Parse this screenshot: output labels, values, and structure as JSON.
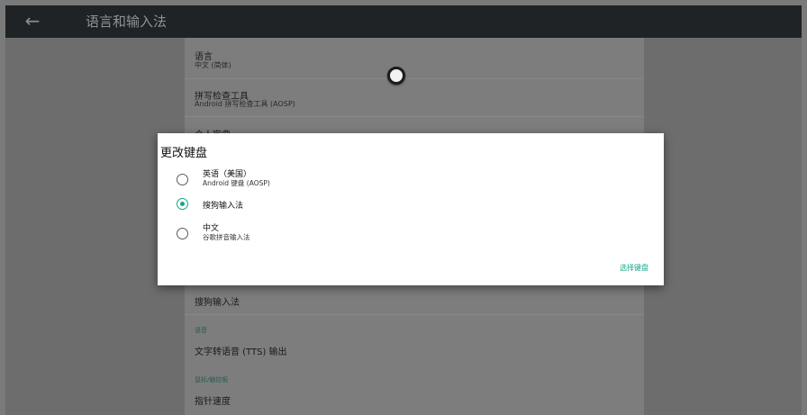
{
  "appbar": {
    "back_icon": "arrow-left-icon",
    "title": "语言和输入法"
  },
  "settings": {
    "language": {
      "title": "语言",
      "subtitle": "中文 (简体)"
    },
    "spellcheck": {
      "title": "拼写检查工具",
      "subtitle": "Android 拼写检查工具 (AOSP)"
    },
    "personal_dict": {
      "title": "个人字典"
    },
    "current_keyboard": {
      "title": "搜狗输入法"
    },
    "speech_category": "语音",
    "tts": {
      "title": "文字转语音 (TTS) 输出"
    },
    "pointer_category": "鼠标/触控板",
    "pointer_speed": {
      "title": "指针速度"
    }
  },
  "dialog": {
    "title": "更改键盘",
    "options": [
      {
        "title": "英语（美国）",
        "subtitle": "Android 键盘 (AOSP)",
        "checked": false
      },
      {
        "title": "搜狗输入法",
        "subtitle": "",
        "checked": true
      },
      {
        "title": "中文",
        "subtitle": "谷歌拼音输入法",
        "checked": false
      }
    ],
    "action_label": "选择键盘"
  },
  "colors": {
    "accent": "#17a589",
    "appbar": "#1f2326",
    "scrim": "#7a7a7a"
  }
}
